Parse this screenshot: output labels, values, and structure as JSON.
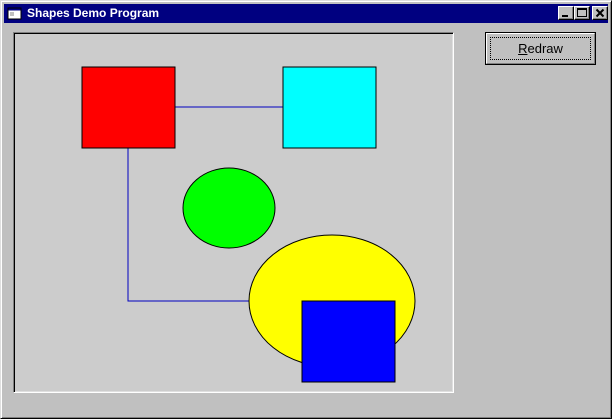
{
  "window": {
    "title": "Shapes Demo Program",
    "icon": "app-window-icon",
    "controls": {
      "minimize": "minimize-icon",
      "maximize": "maximize-icon",
      "close": "close-icon"
    }
  },
  "toolbar": {
    "redraw_mnemonic": "R",
    "redraw_rest": "edraw"
  },
  "shapes": [
    {
      "kind": "rectangle",
      "name": "red-square",
      "fill": "#ff0000"
    },
    {
      "kind": "rectangle",
      "name": "cyan-square",
      "fill": "#00ffff"
    },
    {
      "kind": "ellipse",
      "name": "green-circle",
      "fill": "#00ff00"
    },
    {
      "kind": "ellipse",
      "name": "yellow-ellipse",
      "fill": "#ffff00"
    },
    {
      "kind": "rectangle",
      "name": "blue-square",
      "fill": "#0000ff"
    }
  ],
  "connector_color": "#0000c0",
  "canvas_background": "#cccccc"
}
